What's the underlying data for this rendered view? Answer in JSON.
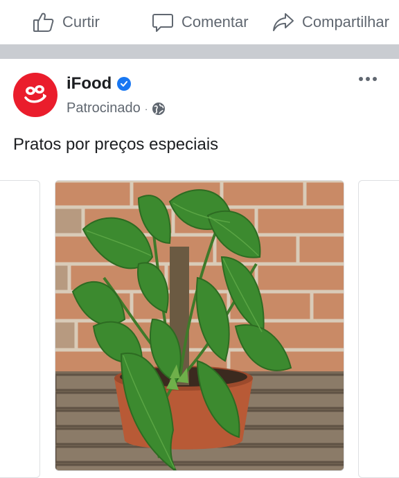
{
  "actions": {
    "like_label": "Curtir",
    "comment_label": "Comentar",
    "share_label": "Compartilhar"
  },
  "post": {
    "page_name": "iFood",
    "sponsored_label": "Patrocinado",
    "separator": "·",
    "text": "Pratos por preços especiais"
  },
  "colors": {
    "brand": "#ea1d2c",
    "verified": "#1877f2",
    "divider": "#c9ccd1",
    "secondary_text": "#606770"
  },
  "icons": {
    "like": "thumbs-up-icon",
    "comment": "comment-bubble-icon",
    "share": "share-arrow-icon",
    "verified": "verified-badge-icon",
    "privacy": "globe-icon",
    "more": "more-options-icon"
  }
}
